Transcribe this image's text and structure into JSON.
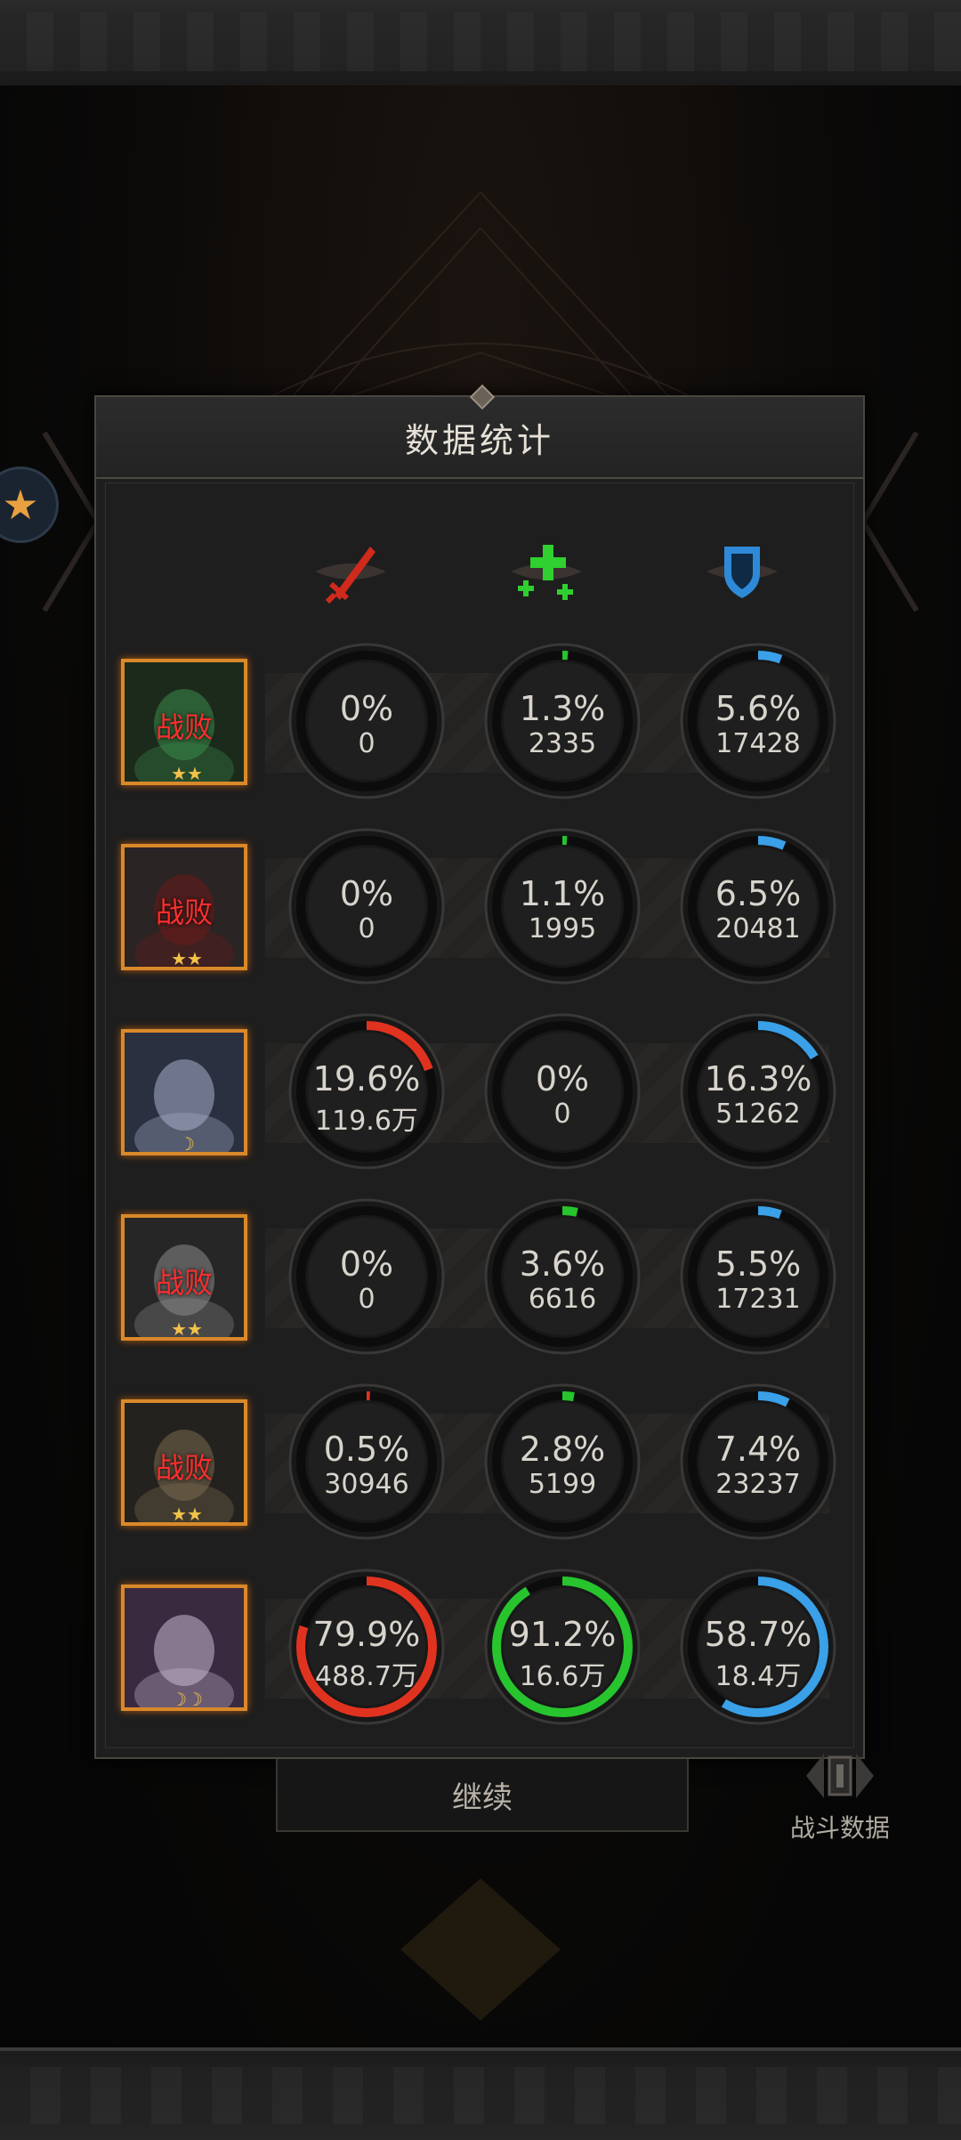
{
  "panel": {
    "title": "数据统计"
  },
  "columns": [
    {
      "icon": "red-sword-icon",
      "color": "#e0331f"
    },
    {
      "icon": "green-heal-cross-icon",
      "color": "#27c42e"
    },
    {
      "icon": "blue-shield-icon",
      "color": "#3aa0e8"
    }
  ],
  "rows": [
    {
      "status": "战败",
      "badge": "★★",
      "stats": [
        {
          "pct": "0%",
          "value": "0",
          "fraction": 0
        },
        {
          "pct": "1.3%",
          "value": "2335",
          "fraction": 0.013
        },
        {
          "pct": "5.6%",
          "value": "17428",
          "fraction": 0.056
        }
      ]
    },
    {
      "status": "战败",
      "badge": "★★",
      "stats": [
        {
          "pct": "0%",
          "value": "0",
          "fraction": 0
        },
        {
          "pct": "1.1%",
          "value": "1995",
          "fraction": 0.011
        },
        {
          "pct": "6.5%",
          "value": "20481",
          "fraction": 0.065
        }
      ]
    },
    {
      "status": "",
      "badge": "☽",
      "stats": [
        {
          "pct": "19.6%",
          "value": "119.6万",
          "fraction": 0.196
        },
        {
          "pct": "0%",
          "value": "0",
          "fraction": 0
        },
        {
          "pct": "16.3%",
          "value": "51262",
          "fraction": 0.163
        }
      ]
    },
    {
      "status": "战败",
      "badge": "★★",
      "stats": [
        {
          "pct": "0%",
          "value": "0",
          "fraction": 0
        },
        {
          "pct": "3.6%",
          "value": "6616",
          "fraction": 0.036
        },
        {
          "pct": "5.5%",
          "value": "17231",
          "fraction": 0.055
        }
      ]
    },
    {
      "status": "战败",
      "badge": "★★",
      "stats": [
        {
          "pct": "0.5%",
          "value": "30946",
          "fraction": 0.005
        },
        {
          "pct": "2.8%",
          "value": "5199",
          "fraction": 0.028
        },
        {
          "pct": "7.4%",
          "value": "23237",
          "fraction": 0.074
        }
      ]
    },
    {
      "status": "",
      "badge": "☽☽",
      "stats": [
        {
          "pct": "79.9%",
          "value": "488.7万",
          "fraction": 0.799
        },
        {
          "pct": "91.2%",
          "value": "16.6万",
          "fraction": 0.912
        },
        {
          "pct": "58.7%",
          "value": "18.4万",
          "fraction": 0.587
        }
      ]
    }
  ],
  "continue_label": "继续",
  "battle_data_label": "战斗数据"
}
